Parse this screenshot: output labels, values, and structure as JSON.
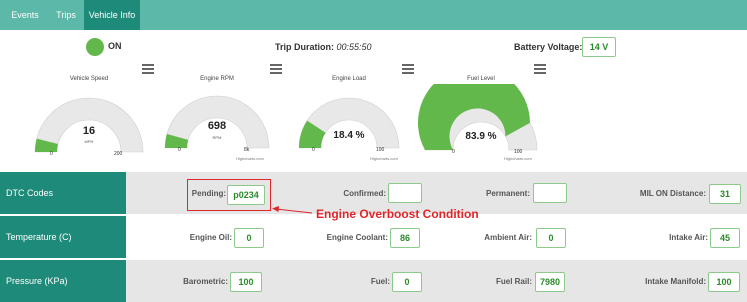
{
  "tabs": [
    {
      "label": "Events",
      "active": false
    },
    {
      "label": "Trips",
      "active": false
    },
    {
      "label": "Vehicle Info",
      "active": true
    }
  ],
  "status": {
    "text": "ON",
    "color": "#62b84a"
  },
  "trip": {
    "label": "Trip Duration:",
    "value": "00:55:50"
  },
  "battery": {
    "label": "Battery Voltage:",
    "value": "14 V"
  },
  "gauges": [
    {
      "title": "Vehicle Speed",
      "value": "16",
      "unit": "MPH",
      "min": "0",
      "max": "200",
      "fraction": 0.08,
      "credit": ""
    },
    {
      "title": "Engine RPM",
      "value": "698",
      "unit": "RPM",
      "min": "0",
      "max": "8k",
      "fraction": 0.087,
      "credit": "Highcharts.com"
    },
    {
      "title": "Engine Load",
      "value": "18.4 %",
      "unit": "",
      "min": "0",
      "max": "100",
      "fraction": 0.184,
      "credit": "Highcharts.com"
    },
    {
      "title": "Fuel Level",
      "value": "83.9 %",
      "unit": "",
      "min": "0",
      "max": "100",
      "fraction": 0.839,
      "credit": "Highcharts.com"
    }
  ],
  "rows": {
    "dtc": {
      "header": "DTC Codes",
      "pending_label": "Pending:",
      "pending_value": "p0234",
      "confirmed_label": "Confirmed:",
      "confirmed_value": "",
      "permanent_label": "Permanent:",
      "permanent_value": "",
      "mil_label": "MIL ON Distance:",
      "mil_value": "31"
    },
    "temperature": {
      "header": "Temperature (C)",
      "oil_label": "Engine Oil:",
      "oil_value": "0",
      "coolant_label": "Engine Coolant:",
      "coolant_value": "86",
      "ambient_label": "Ambient Air:",
      "ambient_value": "0",
      "intake_label": "Intake Air:",
      "intake_value": "45"
    },
    "pressure": {
      "header": "Pressure (KPa)",
      "baro_label": "Barometric:",
      "baro_value": "100",
      "fuel_label": "Fuel:",
      "fuel_value": "0",
      "rail_label": "Fuel Rail:",
      "rail_value": "7980",
      "manifold_label": "Intake Manifold:",
      "manifold_value": "100"
    }
  },
  "annotation": {
    "text": "Engine Overboost Condition",
    "color": "#e0262b"
  },
  "colors": {
    "teal_dark": "#1e8a7a",
    "teal_light": "#5cb8a8",
    "gauge_fill": "#62b84a",
    "gauge_track": "#e8e8e8"
  }
}
